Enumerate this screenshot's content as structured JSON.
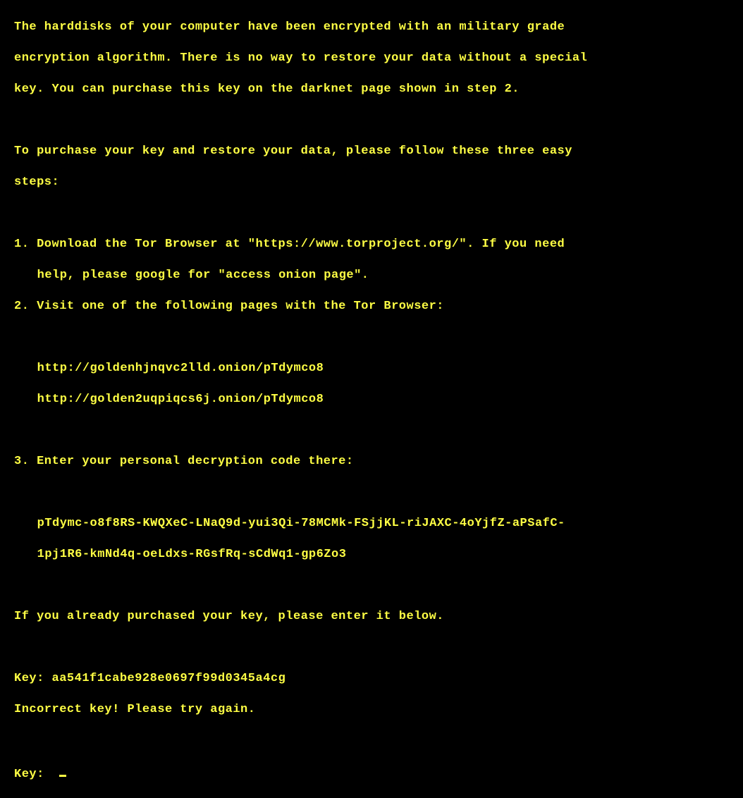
{
  "intro_line1": "The harddisks of your computer have been encrypted with an military grade",
  "intro_line2": "encryption algorithm. There is no way to restore your data without a special",
  "intro_line3": "key. You can purchase this key on the darknet page shown in step 2.",
  "instruct_line1": "To purchase your key and restore your data, please follow these three easy",
  "instruct_line2": "steps:",
  "step1_line1": "1. Download the Tor Browser at \"https://www.torproject.org/\". If you need",
  "step1_line2": "help, please google for \"access onion page\".",
  "step2_line1": "2. Visit one of the following pages with the Tor Browser:",
  "url1": "http://goldenhjnqvc2lld.onion/pTdymco8",
  "url2": "http://golden2uqpiqcs6j.onion/pTdymco8",
  "step3_line1": "3. Enter your personal decryption code there:",
  "code_line1": "pTdymc-o8f8RS-KWQXeC-LNaQ9d-yui3Qi-78MCMk-FSjjKL-riJAXC-4oYjfZ-aPSafC-",
  "code_line2": "1pj1R6-kmNd4q-oeLdxs-RGsfRq-sCdWq1-gp6Zo3",
  "already": "If you already purchased your key, please enter it below.",
  "key_label": "Key:",
  "entered_key": "aa541f1cabe928e0697f99d0345a4cg",
  "error_msg": "Incorrect key! Please try again.",
  "key_prompt2": "Key:"
}
